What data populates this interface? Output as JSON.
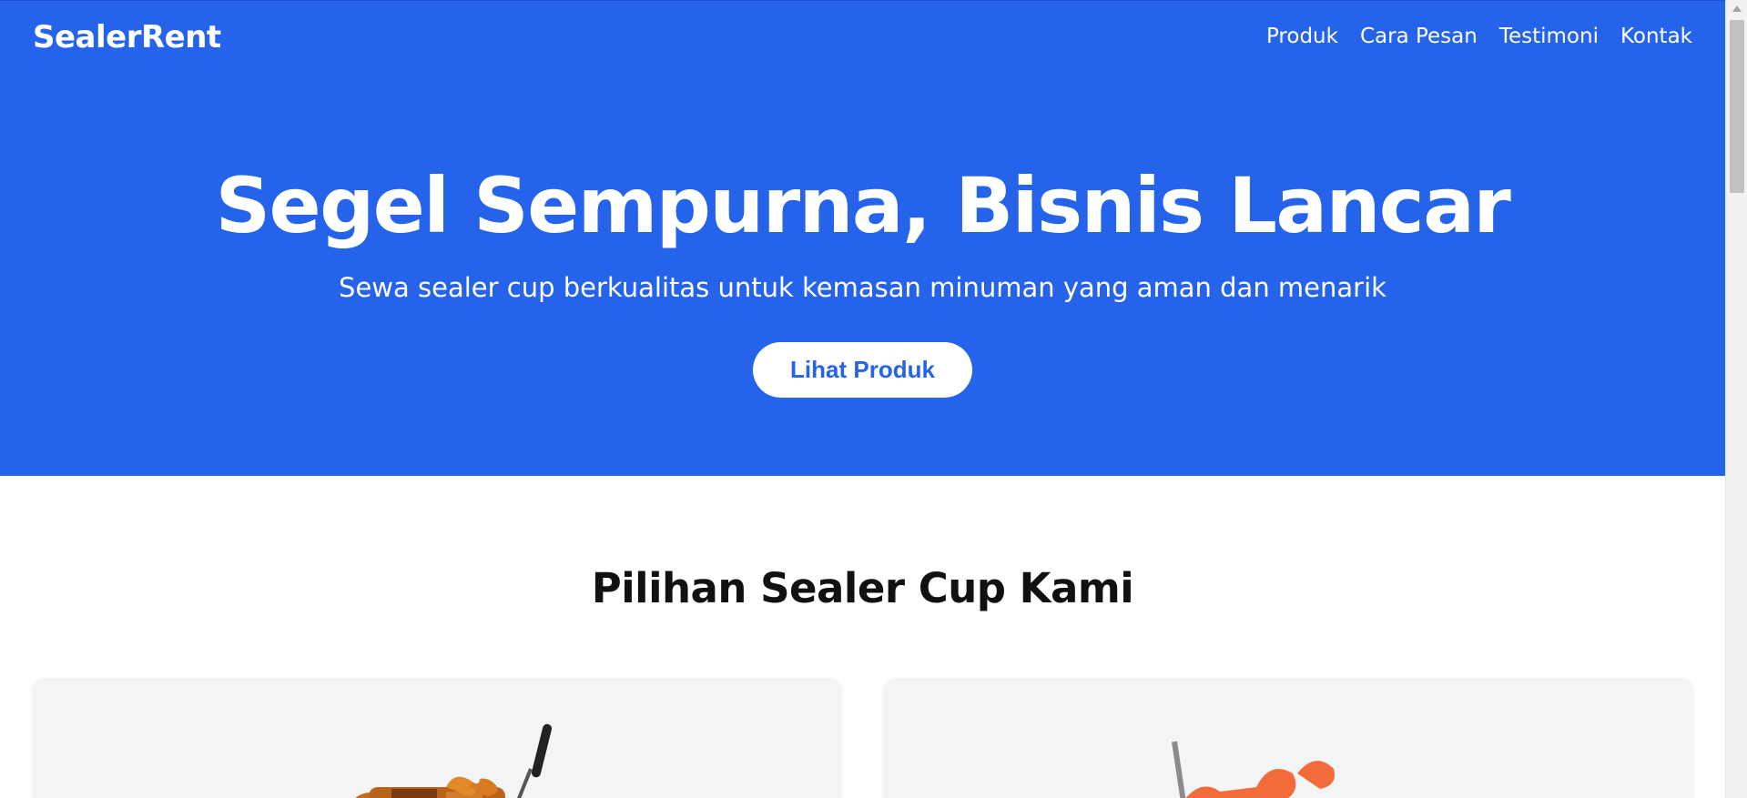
{
  "header": {
    "brand": "SealerRent",
    "nav": [
      "Produk",
      "Cara Pesan",
      "Testimoni",
      "Kontak"
    ]
  },
  "hero": {
    "title": "Segel Sempurna, Bisnis Lancar",
    "subtitle": "Sewa sealer cup berkualitas untuk kemasan minuman yang aman dan menarik",
    "cta_label": "Lihat Produk"
  },
  "products": {
    "section_title": "Pilihan Sealer Cup Kami"
  },
  "colors": {
    "primary": "#2563eb",
    "card_bg": "#f3f4f6",
    "text_dark": "#111111"
  }
}
